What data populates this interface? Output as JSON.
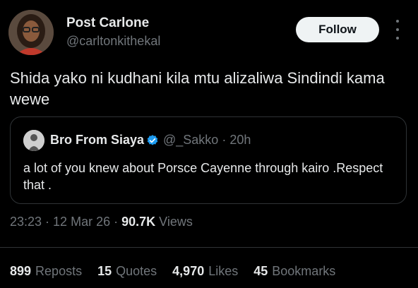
{
  "author": {
    "name": "Post Carlone",
    "handle": "@carltonkithekal"
  },
  "follow_label": "Follow",
  "tweet_text": "Shida yako ni kudhani kila mtu alizaliwa Sindindi kama wewe",
  "quote": {
    "name": "Bro From Siaya",
    "handle": "@_Sakko",
    "age": "20h",
    "text": "a lot of you knew about Porsce Cayenne through kairo .Respect that ."
  },
  "meta": {
    "time": "23:23",
    "date": "12 Mar 26",
    "views_count": "90.7K",
    "views_label": "Views"
  },
  "stats": [
    {
      "count": "899",
      "label": "Reposts"
    },
    {
      "count": "15",
      "label": "Quotes"
    },
    {
      "count": "4,970",
      "label": "Likes"
    },
    {
      "count": "45",
      "label": "Bookmarks"
    }
  ],
  "icons": {
    "verified": "verified-badge-icon",
    "more": "more-options-icon"
  },
  "colors": {
    "background": "#000000",
    "text": "#e7e9ea",
    "muted": "#71767b",
    "verified": "#1d9bf0"
  }
}
